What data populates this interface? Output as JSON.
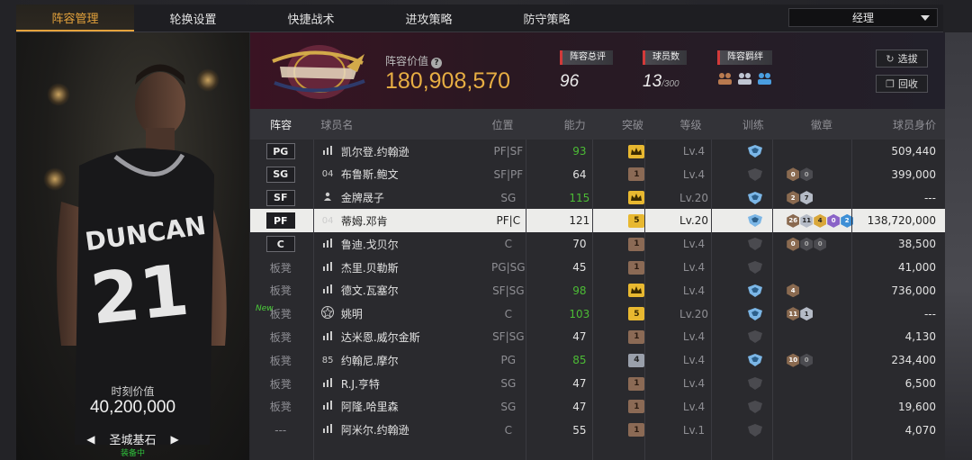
{
  "tabs": [
    {
      "label": "阵容管理",
      "active": true
    },
    {
      "label": "轮换设置",
      "active": false
    },
    {
      "label": "快捷战术",
      "active": false
    },
    {
      "label": "进攻策略",
      "active": false
    },
    {
      "label": "防守策略",
      "active": false
    }
  ],
  "role_select": {
    "value": "经理"
  },
  "left_panel": {
    "value_label": "时刻价值",
    "value": "40,200,000",
    "player_name": "圣城基石",
    "equip_status": "装备中",
    "jersey_name": "DUNCAN",
    "jersey_number": "21"
  },
  "header": {
    "team_value_label": "阵容价值",
    "team_value": "180,908,570",
    "rating_label": "阵容总评",
    "rating_value": "96",
    "players_label": "球员数",
    "players_value": "13",
    "players_max": "/300",
    "bond_label": "阵容羁绊",
    "select_button": "选拔",
    "recycle_button": "回收"
  },
  "columns": [
    "阵容",
    "球员名",
    "位置",
    "能力",
    "突破",
    "等级",
    "训练",
    "徽章",
    "球员身价"
  ],
  "rows": [
    {
      "slot": "PG",
      "icon": "bars",
      "name": "凯尔登.约翰逊",
      "pos": "PF|SF",
      "ability": "93",
      "ability_green": true,
      "brk": "gold-crown",
      "brk_text": "",
      "level": "Lv.4",
      "train": "blue",
      "badges": [],
      "value": "509,440"
    },
    {
      "slot": "SG",
      "icon": "04",
      "name": "布鲁斯.鲍文",
      "pos": "SF|PF",
      "ability": "64",
      "ability_green": false,
      "brk": "brown",
      "brk_text": "1",
      "level": "Lv.4",
      "train": "dark",
      "badges": [
        {
          "t": "b",
          "v": "0"
        },
        {
          "t": "d",
          "v": "0"
        }
      ],
      "value": "399,000"
    },
    {
      "slot": "SF",
      "icon": "person",
      "name": "金牌晟子",
      "pos": "SG",
      "ability": "115",
      "ability_green": true,
      "brk": "gold-crown",
      "brk_text": "",
      "level": "Lv.20",
      "train": "blue",
      "badges": [
        {
          "t": "b",
          "v": "2"
        },
        {
          "t": "s",
          "v": "7"
        }
      ],
      "value": "---"
    },
    {
      "slot": "PF",
      "icon": "04",
      "name": "蒂姆.邓肯",
      "pos": "PF|C",
      "ability": "121",
      "ability_green": false,
      "brk": "gold",
      "brk_text": "5",
      "level": "Lv.20",
      "train": "blue",
      "badges": [
        {
          "t": "b",
          "v": "26"
        },
        {
          "t": "s",
          "v": "11"
        },
        {
          "t": "g",
          "v": "4"
        },
        {
          "t": "p",
          "v": "0"
        },
        {
          "t": "bl",
          "v": "2"
        }
      ],
      "value": "138,720,000",
      "selected": true
    },
    {
      "slot": "C",
      "icon": "bars",
      "name": "鲁迪.戈贝尔",
      "pos": "C",
      "ability": "70",
      "ability_green": false,
      "brk": "brown",
      "brk_text": "1",
      "level": "Lv.4",
      "train": "dark",
      "badges": [
        {
          "t": "b",
          "v": "0"
        },
        {
          "t": "d",
          "v": "0"
        },
        {
          "t": "d",
          "v": "0"
        }
      ],
      "value": "38,500"
    },
    {
      "slot": "板凳",
      "icon": "bars",
      "name": "杰里.贝勒斯",
      "pos": "PG|SG",
      "ability": "45",
      "ability_green": false,
      "brk": "brown",
      "brk_text": "1",
      "level": "Lv.4",
      "train": "dark",
      "badges": [],
      "value": "41,000"
    },
    {
      "slot": "板凳",
      "icon": "bars",
      "name": "德文.瓦塞尔",
      "pos": "SF|SG",
      "ability": "98",
      "ability_green": true,
      "brk": "gold-crown",
      "brk_text": "",
      "level": "Lv.4",
      "train": "blue",
      "badges": [
        {
          "t": "b",
          "v": "4"
        }
      ],
      "value": "736,000"
    },
    {
      "slot": "板凳",
      "icon": "star",
      "name": "姚明",
      "pos": "C",
      "ability": "103",
      "ability_green": true,
      "brk": "gold",
      "brk_text": "5",
      "level": "Lv.20",
      "train": "blue",
      "badges": [
        {
          "t": "b",
          "v": "11"
        },
        {
          "t": "s",
          "v": "1"
        }
      ],
      "value": "---",
      "new": "New"
    },
    {
      "slot": "板凳",
      "icon": "bars",
      "name": "达米恩.威尔金斯",
      "pos": "SF|SG",
      "ability": "47",
      "ability_green": false,
      "brk": "brown",
      "brk_text": "1",
      "level": "Lv.4",
      "train": "dark",
      "badges": [],
      "value": "4,130"
    },
    {
      "slot": "板凳",
      "icon": "85",
      "name": "约翰尼.摩尔",
      "pos": "PG",
      "ability": "85",
      "ability_green": true,
      "brk": "gray",
      "brk_text": "4",
      "level": "Lv.4",
      "train": "blue",
      "badges": [
        {
          "t": "b",
          "v": "10"
        },
        {
          "t": "d",
          "v": "0"
        }
      ],
      "value": "234,400"
    },
    {
      "slot": "板凳",
      "icon": "bars",
      "name": "R.J.亨特",
      "pos": "SG",
      "ability": "47",
      "ability_green": false,
      "brk": "brown",
      "brk_text": "1",
      "level": "Lv.4",
      "train": "dark",
      "badges": [],
      "value": "6,500"
    },
    {
      "slot": "板凳",
      "icon": "bars",
      "name": "阿隆.哈里森",
      "pos": "SG",
      "ability": "47",
      "ability_green": false,
      "brk": "brown",
      "brk_text": "1",
      "level": "Lv.4",
      "train": "dark",
      "badges": [],
      "value": "19,600"
    },
    {
      "slot": "---",
      "icon": "bars",
      "name": "阿米尔.约翰逊",
      "pos": "C",
      "ability": "55",
      "ability_green": false,
      "brk": "brown",
      "brk_text": "1",
      "level": "Lv.1",
      "train": "dark",
      "badges": [],
      "value": "4,070"
    }
  ],
  "colors": {
    "accent": "#e5a33c",
    "green": "#4cbc35",
    "team": "#5b1a33"
  }
}
